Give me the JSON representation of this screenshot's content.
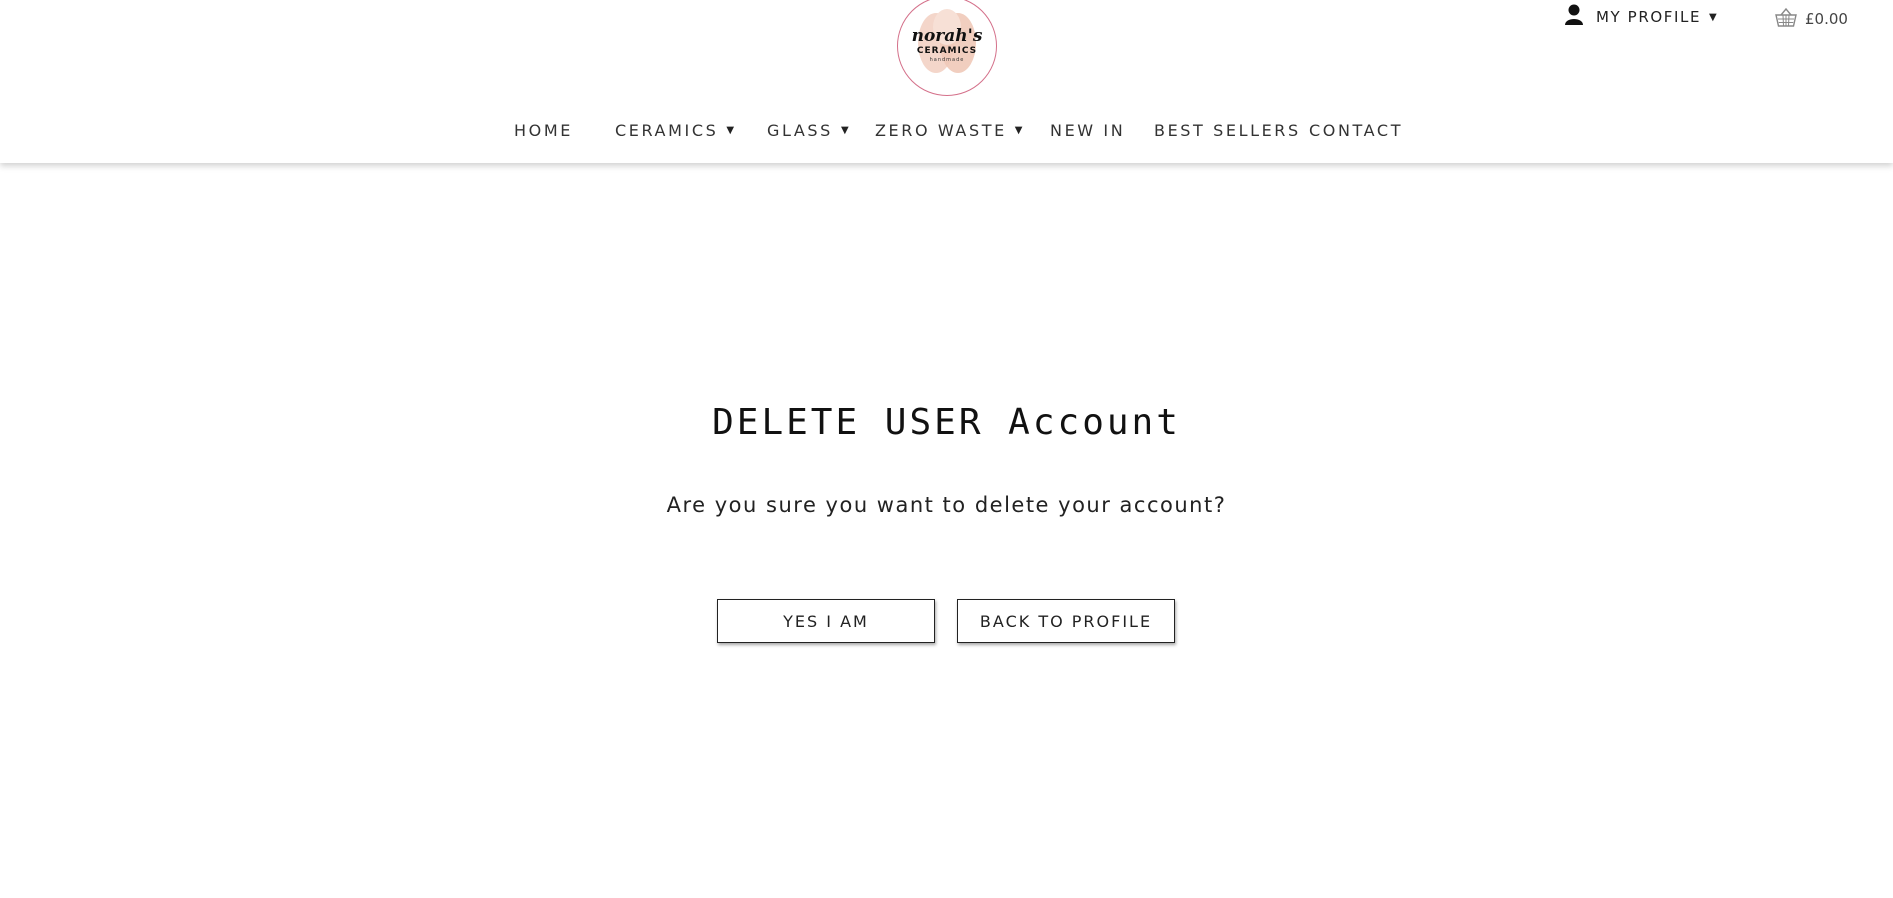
{
  "header": {
    "logo_alt": "norah's CERAMICS handmade",
    "profile": {
      "label": "MY PROFILE",
      "icon": "user-icon"
    },
    "cart": {
      "total": "£0.00",
      "icon": "basket-icon"
    }
  },
  "nav": {
    "items": [
      {
        "label": "HOME",
        "has_dropdown": false
      },
      {
        "label": "CERAMICS",
        "has_dropdown": true
      },
      {
        "label": "GLASS",
        "has_dropdown": true
      },
      {
        "label": "ZERO WASTE",
        "has_dropdown": true
      },
      {
        "label": "NEW IN",
        "has_dropdown": false
      },
      {
        "label": "BEST SELLERS",
        "has_dropdown": false
      },
      {
        "label": "CONTACT",
        "has_dropdown": false
      }
    ]
  },
  "main": {
    "title": "DELETE USER Account",
    "question": "Are you sure you want to delete your account?",
    "confirm_label": "YES I AM",
    "back_label": "BACK TO PROFILE"
  },
  "colors": {
    "logo_ring": "#d4708a",
    "logo_fill": "#f3d2c4",
    "text": "#222222"
  }
}
